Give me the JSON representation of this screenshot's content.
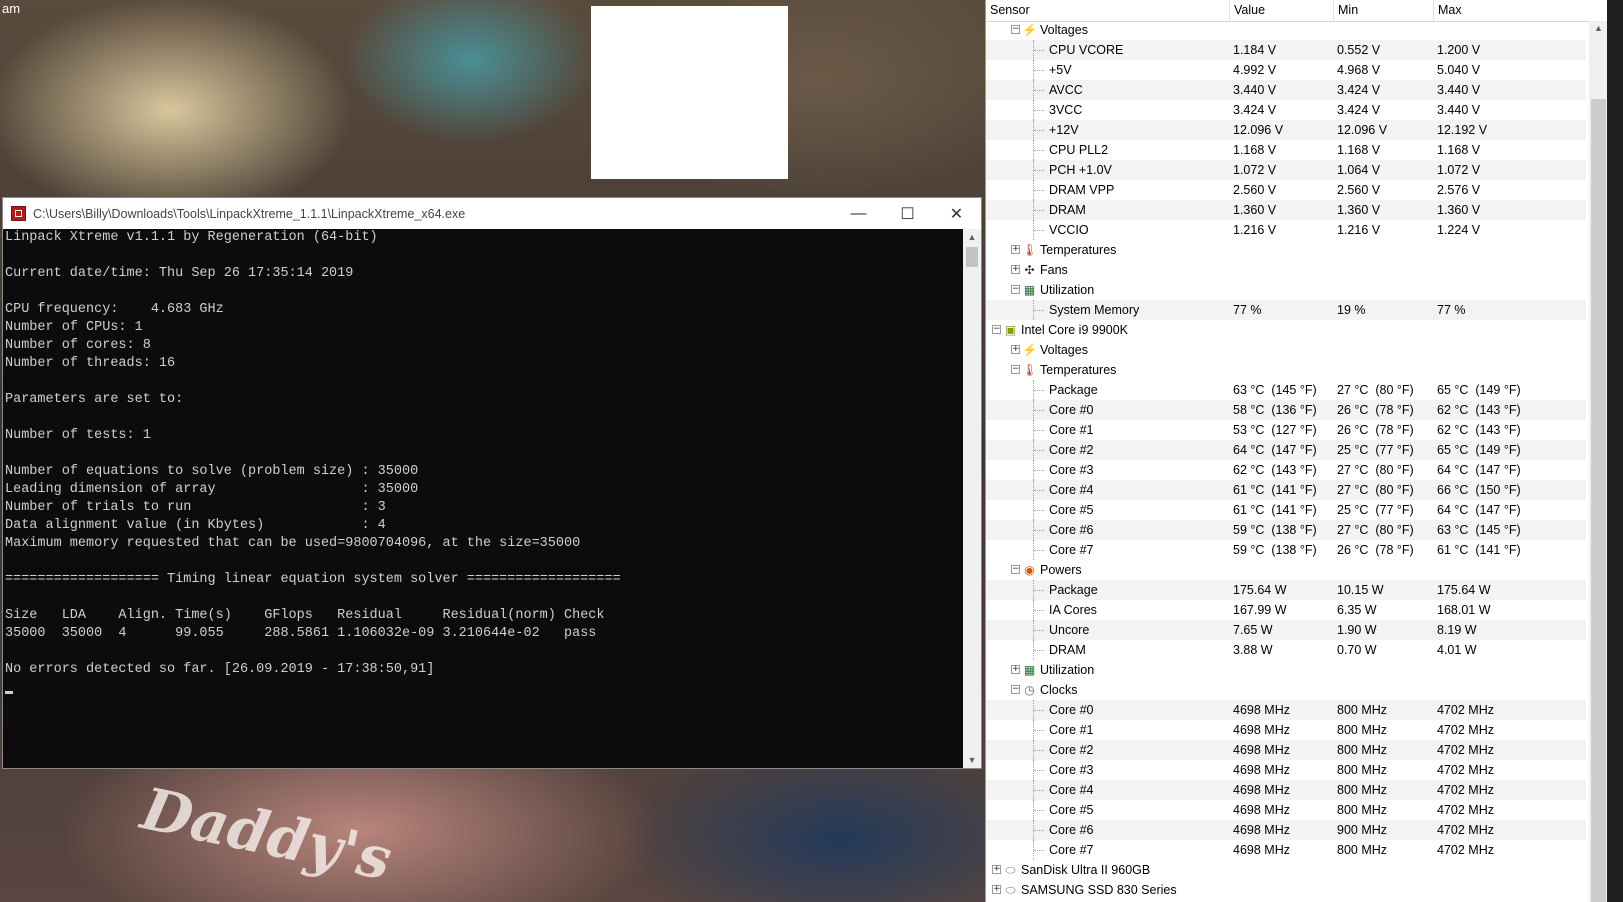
{
  "wallpaper": {
    "corner_text": "am",
    "tattoo_text": "Daddy's"
  },
  "console": {
    "title": "C:\\Users\\Billy\\Downloads\\Tools\\LinpackXtreme_1.1.1\\LinpackXtreme_x64.exe",
    "buttons": {
      "minimize": "—",
      "maximize": "☐",
      "close": "✕"
    },
    "lines": [
      "Linpack Xtreme v1.1.1 by Regeneration (64-bit)",
      "",
      "Current date/time: Thu Sep 26 17:35:14 2019",
      "",
      "CPU frequency:    4.683 GHz",
      "Number of CPUs: 1",
      "Number of cores: 8",
      "Number of threads: 16",
      "",
      "Parameters are set to:",
      "",
      "Number of tests: 1",
      "",
      "Number of equations to solve (problem size) : 35000",
      "Leading dimension of array                  : 35000",
      "Number of trials to run                     : 3",
      "Data alignment value (in Kbytes)            : 4",
      "Maximum memory requested that can be used=9800704096, at the size=35000",
      "",
      "=================== Timing linear equation system solver ===================",
      "",
      "Size   LDA    Align. Time(s)    GFlops   Residual     Residual(norm) Check",
      "35000  35000  4      99.055     288.5861 1.106032e-09 3.210644e-02   pass",
      "",
      "No errors detected so far. [26.09.2019 - 17:38:50,91]"
    ]
  },
  "sensors": {
    "columns": [
      "Sensor",
      "Value",
      "Min",
      "Max"
    ],
    "rows": [
      {
        "type": "group",
        "level": 1,
        "expanded": true,
        "icon": "voltage-icon",
        "label": "Voltages"
      },
      {
        "type": "item",
        "label": "CPU VCORE",
        "value": "1.184 V",
        "min": "0.552 V",
        "max": "1.200 V"
      },
      {
        "type": "item",
        "label": "+5V",
        "value": "4.992 V",
        "min": "4.968 V",
        "max": "5.040 V"
      },
      {
        "type": "item",
        "label": "AVCC",
        "value": "3.440 V",
        "min": "3.424 V",
        "max": "3.440 V"
      },
      {
        "type": "item",
        "label": "3VCC",
        "value": "3.424 V",
        "min": "3.424 V",
        "max": "3.440 V"
      },
      {
        "type": "item",
        "label": "+12V",
        "value": "12.096 V",
        "min": "12.096 V",
        "max": "12.192 V"
      },
      {
        "type": "item",
        "label": "CPU PLL2",
        "value": "1.168 V",
        "min": "1.168 V",
        "max": "1.168 V"
      },
      {
        "type": "item",
        "label": "PCH +1.0V",
        "value": "1.072 V",
        "min": "1.064 V",
        "max": "1.072 V"
      },
      {
        "type": "item",
        "label": "DRAM VPP",
        "value": "2.560 V",
        "min": "2.560 V",
        "max": "2.576 V"
      },
      {
        "type": "item",
        "label": "DRAM",
        "value": "1.360 V",
        "min": "1.360 V",
        "max": "1.360 V"
      },
      {
        "type": "item",
        "label": "VCCIO",
        "value": "1.216 V",
        "min": "1.216 V",
        "max": "1.224 V"
      },
      {
        "type": "group",
        "level": 1,
        "expanded": false,
        "icon": "thermometer-icon",
        "label": "Temperatures"
      },
      {
        "type": "group",
        "level": 1,
        "expanded": false,
        "icon": "fan-icon",
        "label": "Fans"
      },
      {
        "type": "group",
        "level": 1,
        "expanded": true,
        "icon": "utilization-icon",
        "label": "Utilization"
      },
      {
        "type": "item",
        "label": "System Memory",
        "value": "77 %",
        "min": "19 %",
        "max": "77 %"
      },
      {
        "type": "group",
        "level": 0,
        "expanded": true,
        "icon": "cpu-chip-icon",
        "label": "Intel Core i9 9900K"
      },
      {
        "type": "group",
        "level": 1,
        "expanded": false,
        "icon": "voltage-icon",
        "label": "Voltages"
      },
      {
        "type": "group",
        "level": 1,
        "expanded": true,
        "icon": "thermometer-icon",
        "label": "Temperatures"
      },
      {
        "type": "item",
        "label": "Package",
        "value": "63 °C  (145 °F)",
        "min": "27 °C  (80 °F)",
        "max": "65 °C  (149 °F)"
      },
      {
        "type": "item",
        "label": "Core #0",
        "value": "58 °C  (136 °F)",
        "min": "26 °C  (78 °F)",
        "max": "62 °C  (143 °F)"
      },
      {
        "type": "item",
        "label": "Core #1",
        "value": "53 °C  (127 °F)",
        "min": "26 °C  (78 °F)",
        "max": "62 °C  (143 °F)"
      },
      {
        "type": "item",
        "label": "Core #2",
        "value": "64 °C  (147 °F)",
        "min": "25 °C  (77 °F)",
        "max": "65 °C  (149 °F)"
      },
      {
        "type": "item",
        "label": "Core #3",
        "value": "62 °C  (143 °F)",
        "min": "27 °C  (80 °F)",
        "max": "64 °C  (147 °F)"
      },
      {
        "type": "item",
        "label": "Core #4",
        "value": "61 °C  (141 °F)",
        "min": "27 °C  (80 °F)",
        "max": "66 °C  (150 °F)"
      },
      {
        "type": "item",
        "label": "Core #5",
        "value": "61 °C  (141 °F)",
        "min": "25 °C  (77 °F)",
        "max": "64 °C  (147 °F)"
      },
      {
        "type": "item",
        "label": "Core #6",
        "value": "59 °C  (138 °F)",
        "min": "27 °C  (80 °F)",
        "max": "63 °C  (145 °F)"
      },
      {
        "type": "item",
        "label": "Core #7",
        "value": "59 °C  (138 °F)",
        "min": "26 °C  (78 °F)",
        "max": "61 °C  (141 °F)"
      },
      {
        "type": "group",
        "level": 1,
        "expanded": true,
        "icon": "power-icon",
        "label": "Powers"
      },
      {
        "type": "item",
        "label": "Package",
        "value": "175.64 W",
        "min": "10.15 W",
        "max": "175.64 W"
      },
      {
        "type": "item",
        "label": "IA Cores",
        "value": "167.99 W",
        "min": "6.35 W",
        "max": "168.01 W"
      },
      {
        "type": "item",
        "label": "Uncore",
        "value": "7.65 W",
        "min": "1.90 W",
        "max": "8.19 W"
      },
      {
        "type": "item",
        "label": "DRAM",
        "value": "3.88 W",
        "min": "0.70 W",
        "max": "4.01 W"
      },
      {
        "type": "group",
        "level": 1,
        "expanded": false,
        "icon": "utilization-icon",
        "label": "Utilization"
      },
      {
        "type": "group",
        "level": 1,
        "expanded": true,
        "icon": "clock-icon",
        "label": "Clocks"
      },
      {
        "type": "item",
        "label": "Core #0",
        "value": "4698 MHz",
        "min": "800 MHz",
        "max": "4702 MHz"
      },
      {
        "type": "item",
        "label": "Core #1",
        "value": "4698 MHz",
        "min": "800 MHz",
        "max": "4702 MHz"
      },
      {
        "type": "item",
        "label": "Core #2",
        "value": "4698 MHz",
        "min": "800 MHz",
        "max": "4702 MHz"
      },
      {
        "type": "item",
        "label": "Core #3",
        "value": "4698 MHz",
        "min": "800 MHz",
        "max": "4702 MHz"
      },
      {
        "type": "item",
        "label": "Core #4",
        "value": "4698 MHz",
        "min": "800 MHz",
        "max": "4702 MHz"
      },
      {
        "type": "item",
        "label": "Core #5",
        "value": "4698 MHz",
        "min": "800 MHz",
        "max": "4702 MHz"
      },
      {
        "type": "item",
        "label": "Core #6",
        "value": "4698 MHz",
        "min": "900 MHz",
        "max": "4702 MHz"
      },
      {
        "type": "item",
        "label": "Core #7",
        "value": "4698 MHz",
        "min": "800 MHz",
        "max": "4702 MHz"
      },
      {
        "type": "group",
        "level": 0,
        "expanded": false,
        "icon": "disk-icon",
        "label": "SanDisk Ultra II 960GB"
      },
      {
        "type": "group",
        "level": 0,
        "expanded": false,
        "icon": "disk-icon",
        "label": "SAMSUNG SSD 830 Series"
      }
    ]
  },
  "icons": {
    "voltage-icon": "⚡",
    "thermometer-icon": "🌡",
    "fan-icon": "✣",
    "utilization-icon": "▦",
    "cpu-chip-icon": "▣",
    "power-icon": "◉",
    "clock-icon": "◷",
    "disk-icon": "⬭"
  },
  "colors": {
    "console_bg": "#0c0c0c",
    "console_text": "#cfcfcf",
    "voltage": "#c9a100",
    "thermometer": "#c0392b",
    "fan": "#2b2b2b",
    "utilization": "#1e6b2e",
    "cpu_chip": "#8a9a10",
    "power": "#d35400",
    "clock": "#5a5aa0",
    "disk": "#7a7a7a"
  }
}
